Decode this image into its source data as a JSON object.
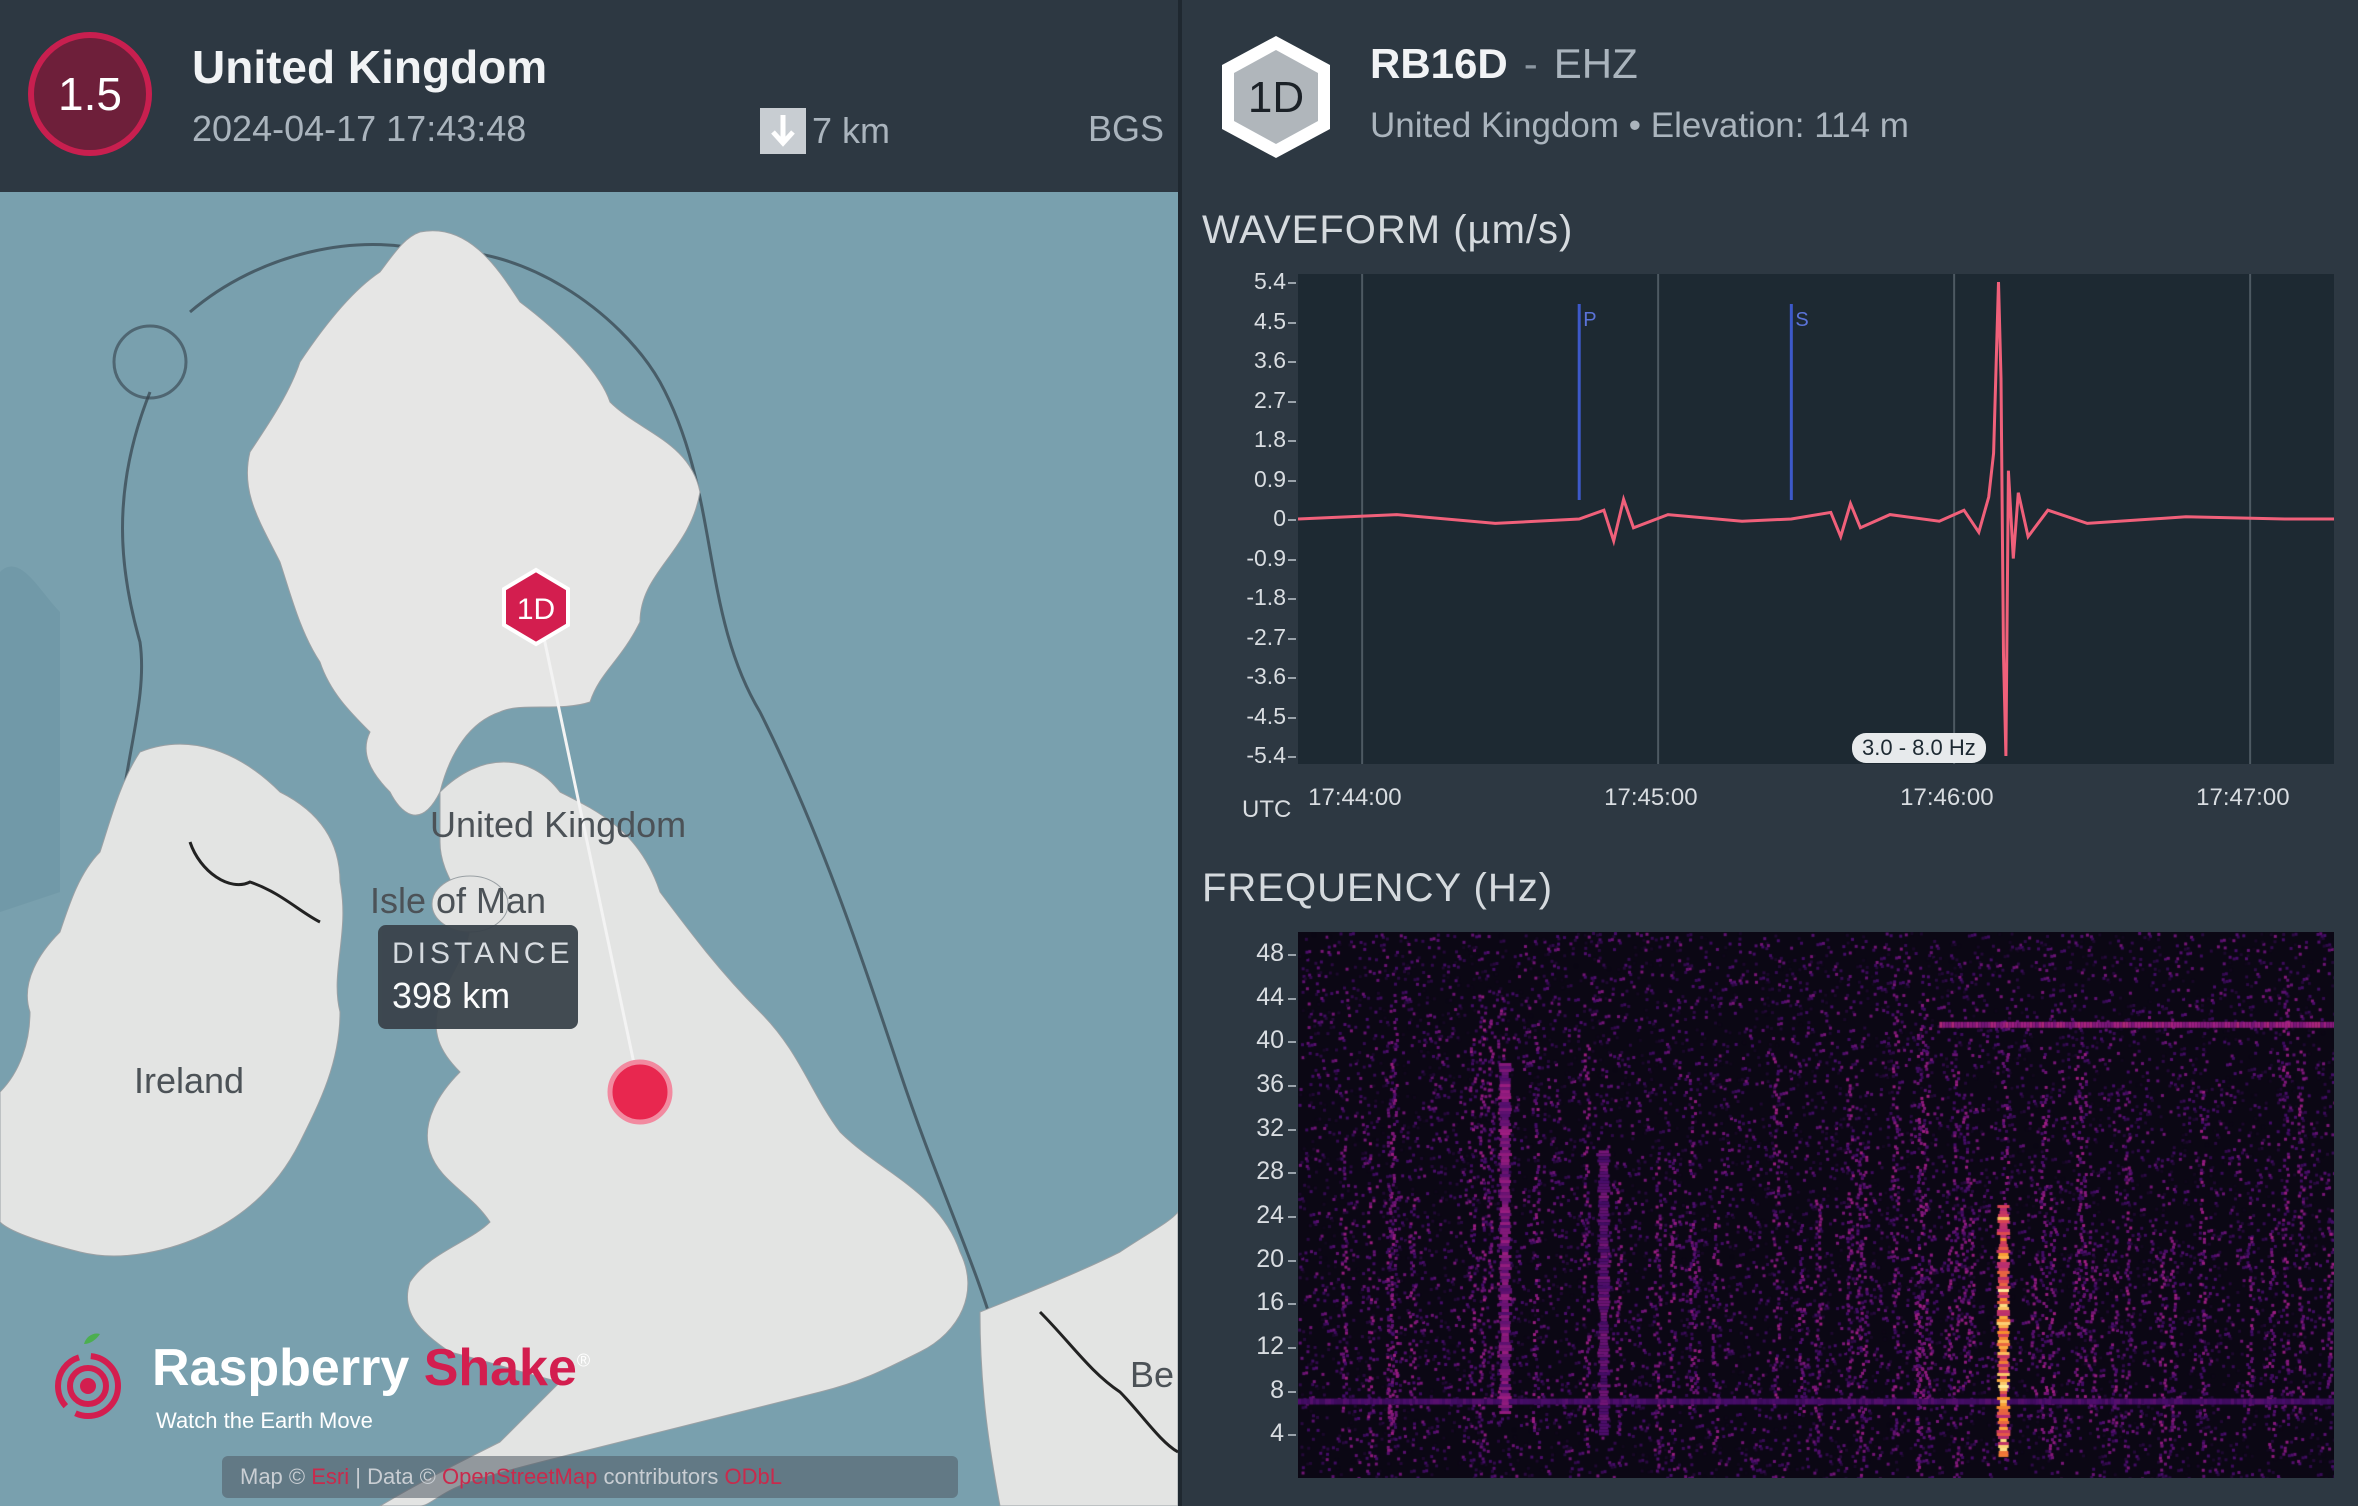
{
  "event": {
    "magnitude": "1.5",
    "region": "United Kingdom",
    "time": "2024-04-17 17:43:48",
    "depth": "7 km",
    "agency": "BGS"
  },
  "map": {
    "distance_label": "DISTANCE",
    "distance_value": "398 km",
    "labels": {
      "uk": "United Kingdom",
      "isle_of_man": "Isle of Man",
      "ireland": "Ireland",
      "belgium_partial": "Be"
    },
    "station_marker": "1D",
    "logo": {
      "name_part1": "Raspberry",
      "name_part2": "Shake",
      "registered": "®",
      "tagline": "Watch the Earth Move"
    },
    "attribution": {
      "prefix": "Map ©",
      "esri": "Esri",
      "data": "| Data ©",
      "osm": "OpenStreetMap",
      "contributors": "contributors",
      "odbl": "ODbL"
    },
    "colors": {
      "sea": "#7aa0ae",
      "land": "#e2e3e3",
      "epicenter": "#e8274f",
      "station": "#d31e4f"
    }
  },
  "station": {
    "badge": "1D",
    "code": "RB16D",
    "separator": "-",
    "channel": "EHZ",
    "location": "United Kingdom",
    "bullet": "•",
    "elevation": "Elevation: 114 m"
  },
  "waveform": {
    "title": "WAVEFORM (µm/s)",
    "utc_label": "UTC",
    "filter": "3.0 - 8.0 Hz",
    "phase_p": "P",
    "phase_s": "S"
  },
  "frequency": {
    "title": "FREQUENCY (Hz)"
  },
  "chart_data": [
    {
      "type": "line",
      "title": "WAVEFORM (µm/s)",
      "xlabel": "UTC",
      "ylabel": "",
      "xticks": [
        "17:44:00",
        "17:45:00",
        "17:46:00",
        "17:47:00"
      ],
      "yticks": [
        "5.4",
        "4.5",
        "3.6",
        "2.7",
        "1.8",
        "0.9",
        "0",
        "-0.9",
        "-1.8",
        "-2.7",
        "-3.6",
        "-4.5",
        "-5.4"
      ],
      "ylim": [
        -5.4,
        5.4
      ],
      "xlim_seconds": [
        0,
        210
      ],
      "phase_markers": [
        {
          "name": "P",
          "t": 57
        },
        {
          "name": "S",
          "t": 100
        }
      ],
      "series": [
        {
          "color": "#f0607a",
          "x": [
            0,
            20,
            40,
            57,
            62,
            64,
            66,
            68,
            75,
            90,
            100,
            108,
            110,
            112,
            114,
            120,
            130,
            135,
            138,
            140,
            141,
            142,
            142.5,
            143,
            143.5,
            144,
            145,
            146,
            148,
            152,
            160,
            180,
            200,
            210
          ],
          "y": [
            0,
            0.1,
            -0.1,
            0,
            0.2,
            -0.5,
            0.45,
            -0.2,
            0.1,
            -0.05,
            0,
            0.15,
            -0.4,
            0.35,
            -0.2,
            0.1,
            -0.05,
            0.2,
            -0.3,
            0.5,
            1.5,
            5.4,
            3.2,
            -3.1,
            -5.4,
            1.1,
            -0.9,
            0.6,
            -0.4,
            0.2,
            -0.1,
            0.05,
            0,
            0
          ]
        }
      ],
      "annotations": [
        "3.0 - 8.0 Hz"
      ]
    },
    {
      "type": "heatmap",
      "title": "FREQUENCY (Hz)",
      "yticks": [
        "48",
        "44",
        "40",
        "36",
        "32",
        "28",
        "24",
        "20",
        "16",
        "12",
        "8",
        "4"
      ],
      "ylim": [
        0,
        50
      ],
      "xlim_seconds": [
        0,
        210
      ],
      "colormap": "inferno",
      "features": [
        {
          "kind": "band",
          "x_from": 130,
          "x_to": 210,
          "freq": 41.5,
          "intensity": 0.6
        },
        {
          "kind": "band",
          "x_from": 0,
          "x_to": 210,
          "freq": 7,
          "intensity": 0.35
        },
        {
          "kind": "burst",
          "x": 143,
          "freq_from": 2,
          "freq_to": 25,
          "intensity": 1.0
        },
        {
          "kind": "burst",
          "x": 42,
          "freq_from": 6,
          "freq_to": 38,
          "intensity": 0.55
        },
        {
          "kind": "burst",
          "x": 62,
          "freq_from": 4,
          "freq_to": 30,
          "intensity": 0.45
        }
      ]
    }
  ]
}
